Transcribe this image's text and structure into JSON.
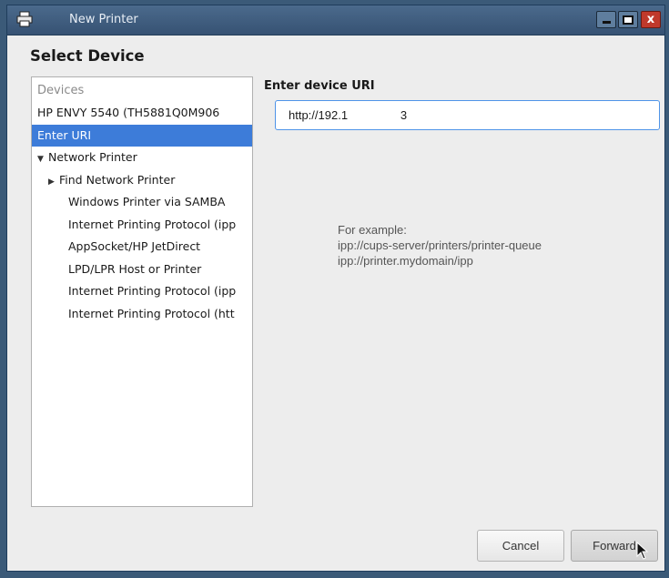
{
  "window": {
    "title": "New Printer",
    "icon": "printer-icon",
    "controls": [
      "minimize-icon",
      "maximize-icon",
      "close-icon"
    ],
    "close_glyph": "x"
  },
  "heading": "Select Device",
  "device_panel": {
    "header": "Devices",
    "items": [
      {
        "label": "HP ENVY 5540 (TH5881Q0M906",
        "level": 0,
        "expander": ""
      },
      {
        "label": "Enter URI",
        "level": 0,
        "expander": "",
        "selected": true
      },
      {
        "label": "Network Printer",
        "level": 0,
        "expander": "▼"
      },
      {
        "label": "Find Network Printer",
        "level": 1,
        "expander": "▶"
      },
      {
        "label": "Windows Printer via SAMBA",
        "level": 2,
        "expander": ""
      },
      {
        "label": "Internet Printing Protocol (ipp",
        "level": 2,
        "expander": ""
      },
      {
        "label": "AppSocket/HP JetDirect",
        "level": 2,
        "expander": ""
      },
      {
        "label": "LPD/LPR Host or Printer",
        "level": 2,
        "expander": ""
      },
      {
        "label": "Internet Printing Protocol (ipp",
        "level": 2,
        "expander": ""
      },
      {
        "label": "Internet Printing Protocol (htt",
        "level": 2,
        "expander": ""
      }
    ]
  },
  "uri": {
    "label": "Enter device URI",
    "value": "http://192.1                3"
  },
  "example": {
    "line1": "For example:",
    "line2": "ipp://cups-server/printers/printer-queue",
    "line3": "ipp://printer.mydomain/ipp"
  },
  "buttons": {
    "cancel": "Cancel",
    "forward": "Forward"
  },
  "colors": {
    "selection": "#3d7cd9",
    "input_focus": "#4f94e8",
    "titlebar": "#4b6a8c",
    "close_button": "#c0392b"
  }
}
